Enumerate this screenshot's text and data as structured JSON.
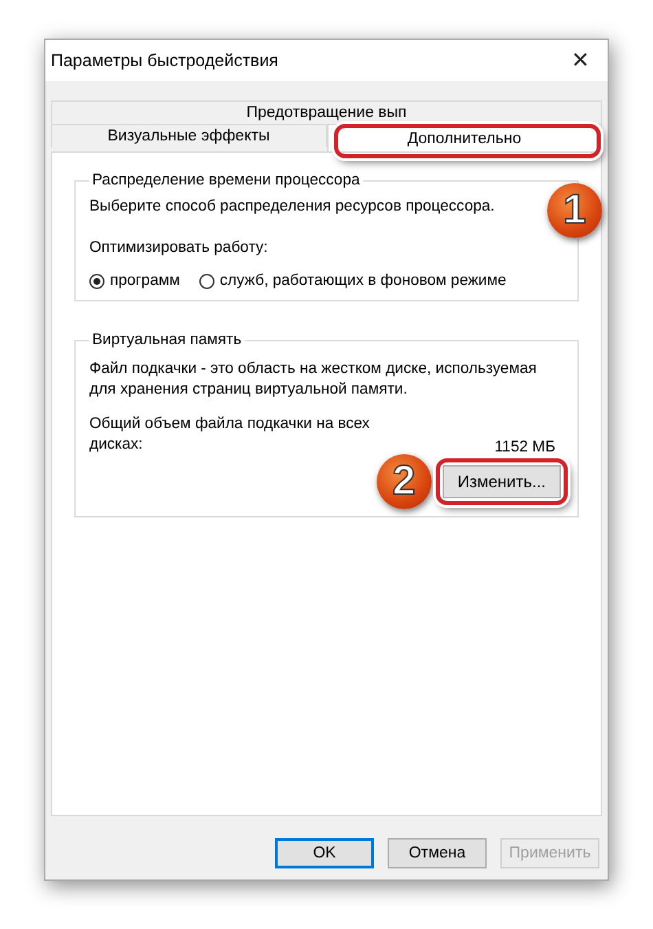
{
  "window": {
    "title": "Параметры быстродействия",
    "close": "✕"
  },
  "tab_rows": [
    [
      {
        "label": "Предотвращение вып",
        "selected": false
      }
    ],
    [
      {
        "label": "Визуальные эффекты",
        "selected": false
      },
      {
        "label": "Дополнительно",
        "selected": true,
        "callout": true
      }
    ]
  ],
  "processor": {
    "title": "Распределение времени процессора",
    "text": "Выберите способ распределения ресурсов процессора.",
    "optimize_label": "Оптимизировать работу:",
    "badge": "1",
    "options": [
      {
        "label": "программ",
        "selected": true
      },
      {
        "label": "служб, работающих в фоновом режиме",
        "selected": false
      }
    ]
  },
  "memory": {
    "title": "Виртуальная память",
    "text": "Файл подкачки - это область на жестком диске, используемая для хранения страниц виртуальной памяти.",
    "total_label": "Общий объем файла подкачки на всех дисках:",
    "total_value": "1152 МБ",
    "badge": "2",
    "change_button": "Изменить..."
  },
  "buttons": [
    {
      "label": "OK",
      "default": true,
      "disabled": false
    },
    {
      "label": "Отмена",
      "default": false,
      "disabled": false
    },
    {
      "label": "Применить",
      "default": false,
      "disabled": true
    }
  ]
}
